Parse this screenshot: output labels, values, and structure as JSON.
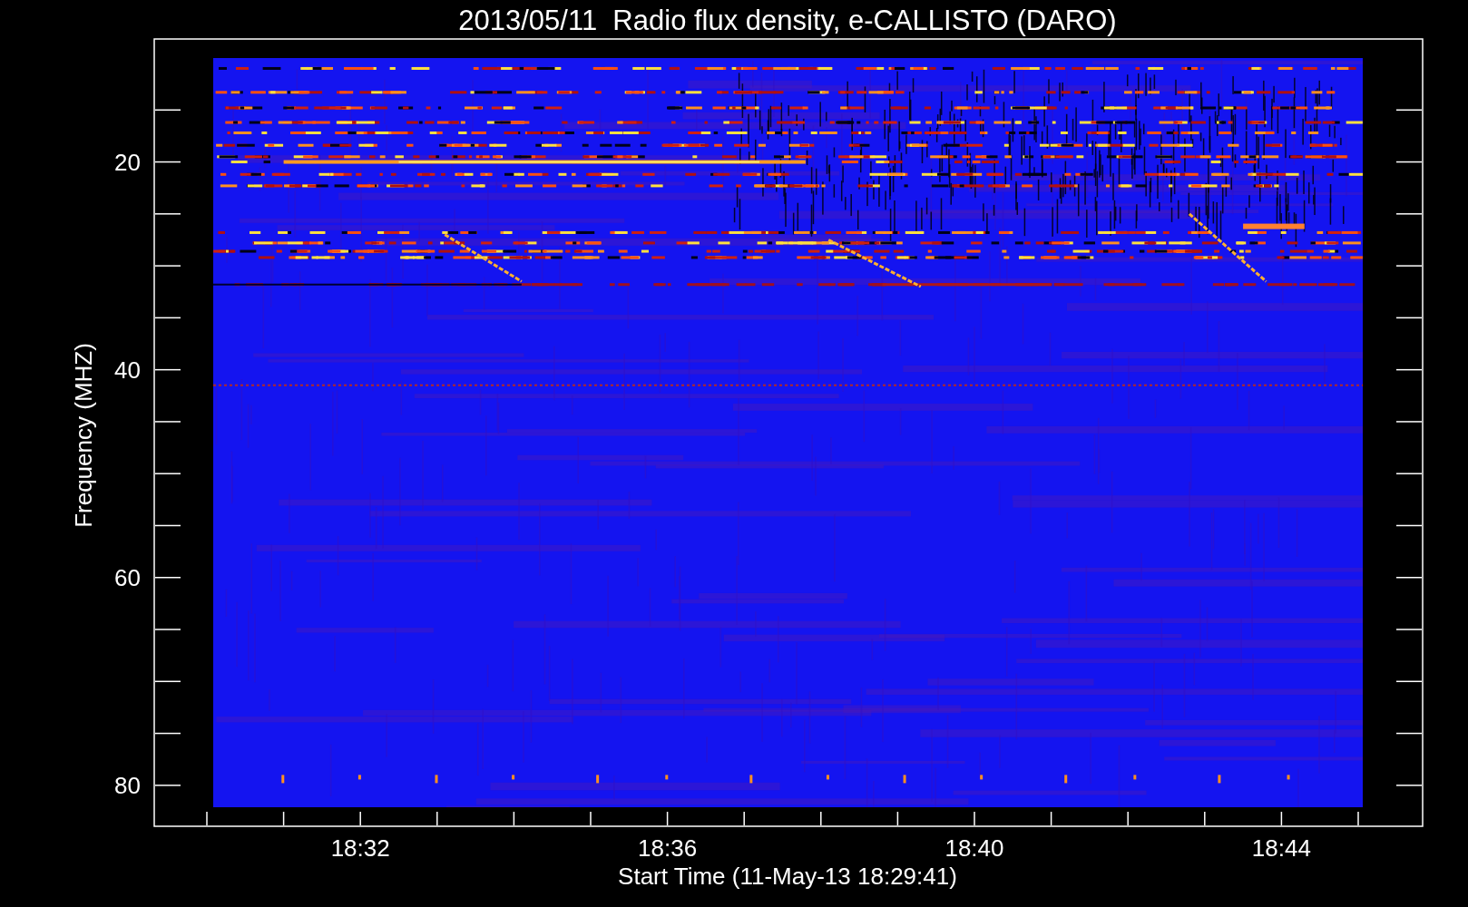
{
  "title": "2013/05/11  Radio flux density, e-CALLISTO (DARO)",
  "y_axis": {
    "label": "Frequency (MHZ)",
    "ticks": [
      "20",
      "40",
      "60",
      "80"
    ]
  },
  "x_axis": {
    "label": "Start Time (11-May-13 18:29:41)",
    "ticks": [
      "18:32",
      "18:36",
      "18:40",
      "18:44"
    ]
  }
}
